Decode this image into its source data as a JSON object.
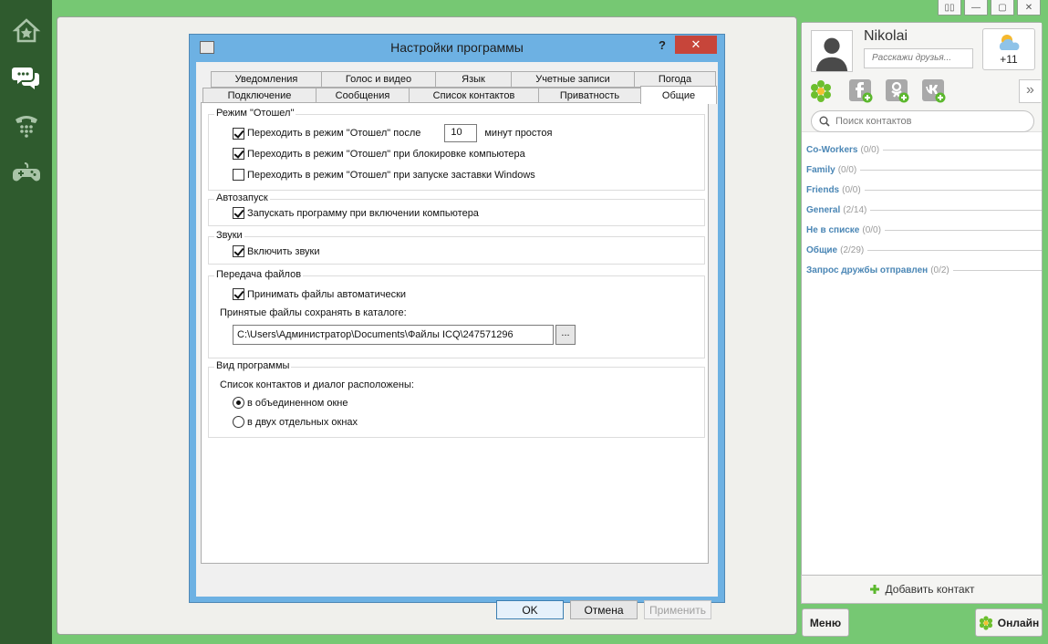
{
  "window": {
    "title_buttons": [
      "▯▯",
      "—",
      "▢",
      "✕"
    ]
  },
  "sidebar": {
    "items": [
      {
        "name": "home",
        "icon": "home-icon"
      },
      {
        "name": "chats",
        "icon": "chat-icon"
      },
      {
        "name": "calls",
        "icon": "phone-icon"
      },
      {
        "name": "games",
        "icon": "gamepad-icon"
      }
    ]
  },
  "profile": {
    "username": "Nikolai",
    "status_placeholder": "Расскажи друзья...",
    "weather_temp": "+11",
    "more": "»"
  },
  "search": {
    "placeholder": "Поиск контактов"
  },
  "groups": [
    {
      "name": "Co-Workers",
      "count": "(0/0)"
    },
    {
      "name": "Family",
      "count": "(0/0)"
    },
    {
      "name": "Friends",
      "count": "(0/0)"
    },
    {
      "name": "General",
      "count": "(2/14)"
    },
    {
      "name": "Не в списке",
      "count": "(0/0)"
    },
    {
      "name": "Общие",
      "count": "(2/29)"
    },
    {
      "name": "Запрос дружбы отправлен",
      "count": "(0/2)"
    }
  ],
  "bottom": {
    "add_contact": "Добавить контакт",
    "menu": "Меню",
    "online": "Онлайн"
  },
  "dialog": {
    "title": "Настройки программы",
    "help": "?",
    "close": "✕",
    "tabs_row1": [
      "Уведомления",
      "Голос и видео",
      "Язык",
      "Учетные записи",
      "Погода"
    ],
    "tabs_row2": [
      "Подключение",
      "Сообщения",
      "Список контактов",
      "Приватность",
      "Общие"
    ],
    "away": {
      "legend": "Режим \"Отошел\"",
      "after_label": "Переходить в режим \"Отошел\" после",
      "minutes_value": "10",
      "minutes_label": "минут простоя",
      "lock_label": "Переходить в режим \"Отошел\" при блокировке компьютера",
      "screensaver_label": "Переходить в режим \"Отошел\" при запуске заставки Windows"
    },
    "autostart": {
      "legend": "Автозапуск",
      "label": "Запускать программу при включении компьютера"
    },
    "sounds": {
      "legend": "Звуки",
      "label": "Включить звуки"
    },
    "files": {
      "legend": "Передача файлов",
      "auto_label": "Принимать файлы автоматически",
      "dir_label": "Принятые файлы сохранять в каталоге:",
      "path": "C:\\Users\\Администратор\\Documents\\Файлы ICQ\\247571296",
      "browse": "..."
    },
    "view": {
      "legend": "Вид программы",
      "label": "Список контактов и диалог расположены:",
      "option1": "в объединенном окне",
      "option2": "в двух отдельных окнах"
    },
    "buttons": {
      "ok": "OK",
      "cancel": "Отмена",
      "apply": "Применить"
    }
  },
  "colors": {
    "sidebar": "#2f5b2e",
    "frame": "#76c873",
    "group_link": "#4a86b5",
    "close_button": "#c7453a",
    "dialog_border": "#6db1e3"
  }
}
